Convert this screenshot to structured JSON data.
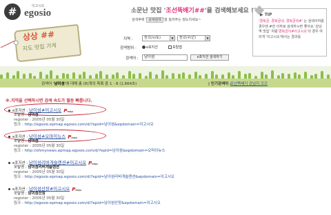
{
  "header": {
    "logo_small": "이고시오",
    "logo_name": "egosio",
    "logo_mark": "#",
    "headline_pre": "소문난 맛집 '",
    "headline_term": "조선뚝배기##",
    "headline_post": "'을 검색해보세요 !!",
    "subline_pre": "검색후에 '",
    "subline_chip": "상세검색",
    "subline_post": "'을 눌러주는 정도치세요~",
    "tag_line1": "상상 ##",
    "tag_line2": "지도 맛집 가게"
  },
  "form": {
    "region_label": "지역 :",
    "region1": "전국(시/도)",
    "region2": "전국(구/군)",
    "scope_label": "검색범위 :",
    "scope_opt1": "e포지션",
    "scope_opt2": "포탈맵",
    "query_label": "검색어 :",
    "query_value": "남이섬",
    "search_button": "e포지션 검색하기"
  },
  "tip": {
    "title": "▶ TIP",
    "body_parts": [
      {
        "text": "'경복궁, 경복궁내, 경복궁외#' ",
        "red": true
      },
      {
        "text": "는 검색어처럼 경우엔 #한 이하로 검색하시면 좋아요 '강남역 맛집' 처럼",
        "red": false
      },
      {
        "text": "'경복궁이#이고시오'",
        "red": true
      },
      {
        "text": "의 경우 여러개 '이고시오'에서는 결과를 ",
        "red": false
      }
    ]
  },
  "results_header": {
    "count_pre": "검색어 '",
    "count_term": "남이섬",
    "count_post": "'에 대해 총 (8)개의 목록 중 1 - 8 (1,664초)",
    "popular_label": "| 인기검색어 :",
    "popular_link": "조선뚝배기 강남지 꼬꼬"
  },
  "notice": "※.지역을 선택하시면 검색 속도가 월등 빠릅니다.",
  "results": [
    {
      "source": "e포지션 :",
      "title": "남이섬#이고시오",
      "shop_label": "포탈명 :",
      "shop": "남이섬",
      "register": "register : 2005년 05월 30일",
      "link_label": "링크 :",
      "url": "http://egosio.epmap.egosio.com/d/?epid=남이섬&epdomain=이고시오",
      "circled": true
    },
    {
      "source": "e포지션 :",
      "title": "남이섬#오마이뉴스",
      "shop_label": "포탈명 :",
      "shop": "남이섬",
      "register": "register : 2005년 05월 30일",
      "link_label": "링크 :",
      "url": "http://ohmynews.epmap.egosio.com/d/?epid=남이섬&epdomain=오마이뉴스",
      "circled": true
    },
    {
      "source": "e포지션 :",
      "title": "남이섬리버개슬렌션#이고시오",
      "shop_label": "포탈명 :",
      "shop": "남이섬리버개슬렌션",
      "register": "register : 2005년 05월 30일",
      "link_label": "링크 :",
      "url": "http://egosio.epmap.egosio.com/d/?epid=남이섬리버개슬렌션&epdomain=이고시오",
      "circled": false
    },
    {
      "source": "e포지션 :",
      "title": "남이섬산장#이고시오",
      "shop_label": "포탈명 :",
      "shop": "남이섬산장",
      "register": "register : 2005년 05월 30일",
      "link_label": "링크 :",
      "url": "http://egosio.epmap.egosio.com/d/?epid=남이섬산장&epdomain=이고시오",
      "circled": false
    }
  ],
  "p_icon": "P",
  "p_icon_sub": "map",
  "colors": {
    "accent": "#e2317a",
    "link": "#2a4fa0",
    "bar": "#c7d88d",
    "ring": "#cc2436"
  }
}
